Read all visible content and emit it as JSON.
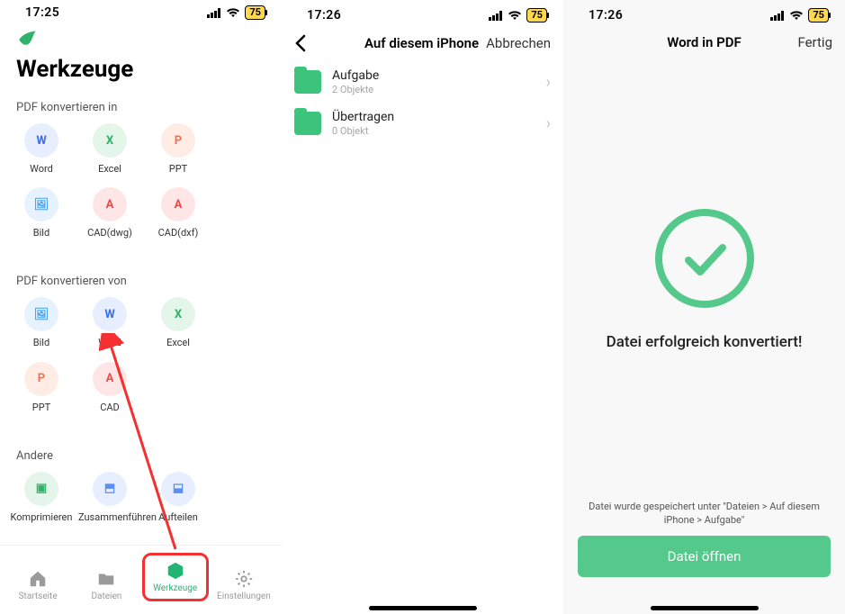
{
  "status": {
    "time1": "17:25",
    "time2": "17:26",
    "time3": "17:26",
    "battery": "75"
  },
  "screen1": {
    "title": "Werkzeuge",
    "section_to": "PDF konvertieren in",
    "section_from": "PDF konvertieren von",
    "section_other": "Andere",
    "tools_to": [
      {
        "label": "Word",
        "name": "pdf-to-word",
        "cls": "ic-blue",
        "glyph": "W"
      },
      {
        "label": "Excel",
        "name": "pdf-to-excel",
        "cls": "ic-green",
        "glyph": "X"
      },
      {
        "label": "PPT",
        "name": "pdf-to-ppt",
        "cls": "ic-orange",
        "glyph": "P"
      },
      {
        "label": "Bild",
        "name": "pdf-to-image",
        "cls": "ic-sky",
        "glyph": "🖼"
      },
      {
        "label": "CAD(dwg)",
        "name": "pdf-to-caddwg",
        "cls": "ic-red",
        "glyph": "A"
      },
      {
        "label": "CAD(dxf)",
        "name": "pdf-to-caddxf",
        "cls": "ic-red",
        "glyph": "A"
      }
    ],
    "tools_from": [
      {
        "label": "Bild",
        "name": "image-to-pdf",
        "cls": "ic-sky",
        "glyph": "🖼"
      },
      {
        "label": "Word",
        "name": "word-to-pdf",
        "cls": "ic-blue",
        "glyph": "W"
      },
      {
        "label": "Excel",
        "name": "excel-to-pdf",
        "cls": "ic-green",
        "glyph": "X"
      },
      {
        "label": "PPT",
        "name": "ppt-to-pdf",
        "cls": "ic-orange",
        "glyph": "P"
      },
      {
        "label": "CAD",
        "name": "cad-to-pdf",
        "cls": "ic-red",
        "glyph": "A"
      }
    ],
    "tools_other": [
      {
        "label": "Komprimieren",
        "name": "compress",
        "cls": "ic-teal",
        "glyph": "▣"
      },
      {
        "label": "Zusammenführen",
        "name": "merge",
        "cls": "ic-bluel",
        "glyph": "⬒"
      },
      {
        "label": "Aufteilen",
        "name": "split",
        "cls": "ic-bluel",
        "glyph": "⬓"
      }
    ],
    "tabs": {
      "home": "Startseite",
      "files": "Dateien",
      "tools": "Werkzeuge",
      "settings": "Einstellungen"
    }
  },
  "screen2": {
    "nav_title": "Auf diesem iPhone",
    "cancel": "Abbrechen",
    "rows": [
      {
        "name": "Aufgabe",
        "sub": "2 Objekte"
      },
      {
        "name": "Übertragen",
        "sub": "0 Objekt"
      }
    ]
  },
  "screen3": {
    "nav_title": "Word in PDF",
    "done": "Fertig",
    "success": "Datei erfolgreich konvertiert!",
    "saved_note": "Datei wurde gespeichert unter \"Dateien > Auf diesem iPhone > Aufgabe\"",
    "open_button": "Datei öffnen"
  }
}
